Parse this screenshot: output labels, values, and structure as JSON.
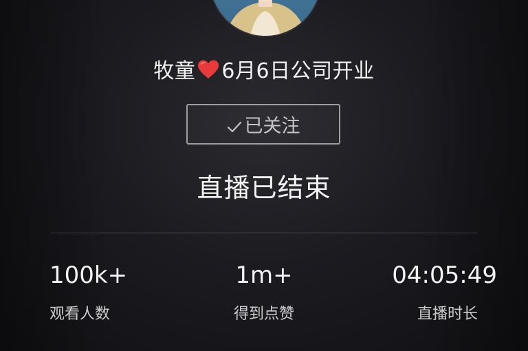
{
  "profile": {
    "avatar_icon": "user-avatar",
    "name": "牧童",
    "heart_icon": "heart-icon",
    "heart_color": "#e83a3a",
    "tagline": "6月6日公司开业"
  },
  "follow_button": {
    "label": "已关注",
    "icon": "check-icon"
  },
  "status": {
    "title": "直播已结束"
  },
  "stats": [
    {
      "value": "100k+",
      "label": "观看人数"
    },
    {
      "value": "1m+",
      "label": "得到点赞"
    },
    {
      "value": "04:05:49",
      "label": "直播时长"
    }
  ]
}
